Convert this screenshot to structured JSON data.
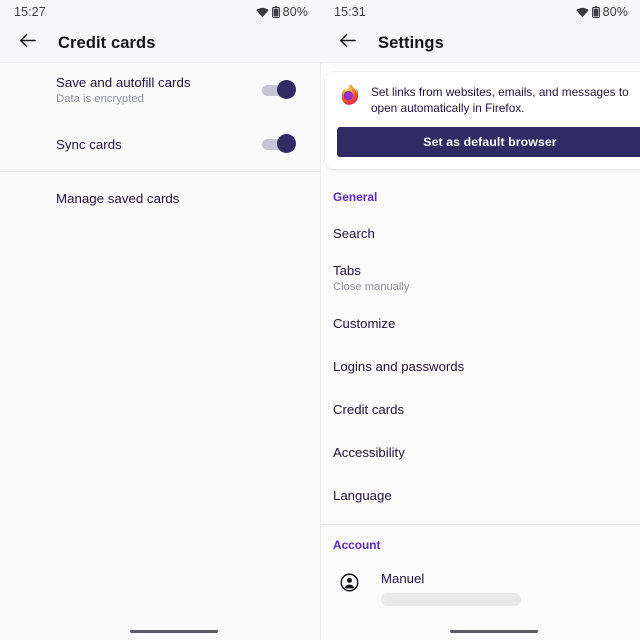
{
  "theme": {
    "accent_purple": "#5b2ac6",
    "button_navy": "#312a65",
    "text_dark": "#20123a",
    "text_muted": "#8f8f9d",
    "pane_bg": "#fafafb",
    "appbar_bg": "#f7f7f9",
    "card_bg": "#ffffff",
    "toggle_track": "#c6c5d6"
  },
  "left_pane": {
    "statusbar": {
      "time": "15:27",
      "battery_label": "80%",
      "wifi_icon": "wifi-icon",
      "battery_icon": "battery-icon"
    },
    "appbar": {
      "back_icon": "arrow-left-icon",
      "title": "Credit cards"
    },
    "prefs": [
      {
        "title": "Save and autofill cards",
        "subtitle": "Data is encrypted",
        "toggle": "on"
      },
      {
        "title": "Sync cards",
        "subtitle": "",
        "toggle": "on"
      }
    ],
    "manage_link": "Manage saved cards"
  },
  "right_pane": {
    "statusbar": {
      "time": "15:31",
      "battery_label": "80%",
      "wifi_icon": "wifi-icon",
      "battery_icon": "battery-icon"
    },
    "appbar": {
      "back_icon": "arrow-left-icon",
      "title": "Settings"
    },
    "default_browser_card": {
      "logo_icon": "firefox-logo-icon",
      "message": "Set links from websites, emails, and messages to open automatically in Firefox.",
      "button_label": "Set as default browser"
    },
    "sections": [
      {
        "header": "General",
        "items": [
          {
            "title": "Search",
            "subtitle": ""
          },
          {
            "title": "Tabs",
            "subtitle": "Close manually"
          },
          {
            "title": "Customize",
            "subtitle": ""
          },
          {
            "title": "Logins and passwords",
            "subtitle": ""
          },
          {
            "title": "Credit cards",
            "subtitle": ""
          },
          {
            "title": "Accessibility",
            "subtitle": ""
          },
          {
            "title": "Language",
            "subtitle": ""
          }
        ]
      }
    ],
    "account": {
      "header": "Account",
      "avatar_icon": "account-circle-icon",
      "name": "Manuel"
    }
  },
  "system": {
    "gesture_bar_icon": "home-gesture-bar"
  }
}
